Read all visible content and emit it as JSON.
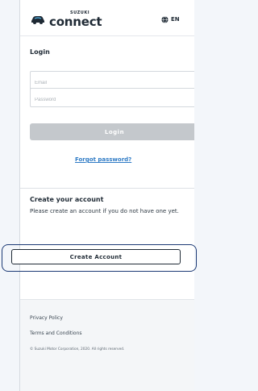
{
  "header": {
    "logo_top": "SUZUKI",
    "logo_main": "connect",
    "lang_label": "EN",
    "lang_icon": "globe-icon"
  },
  "login": {
    "title": "Login",
    "email_placeholder": "Email",
    "password_placeholder": "Password",
    "button_label": "Login",
    "forgot_link": "Forgot password?"
  },
  "create": {
    "title": "Create your account",
    "description": "Please create an account if you do not have one yet.",
    "button_label": "Create Account"
  },
  "footer": {
    "privacy": "Privacy Policy",
    "terms": "Terms and Conditions",
    "copyright": "© Suzuki Motor Corporation, 2020. All rights reserved."
  },
  "colors": {
    "accent_link": "#2f7bc5",
    "disabled_button": "#c4c8cc",
    "highlight_outline": "#1c3a75",
    "text_primary": "#1f2a35"
  }
}
